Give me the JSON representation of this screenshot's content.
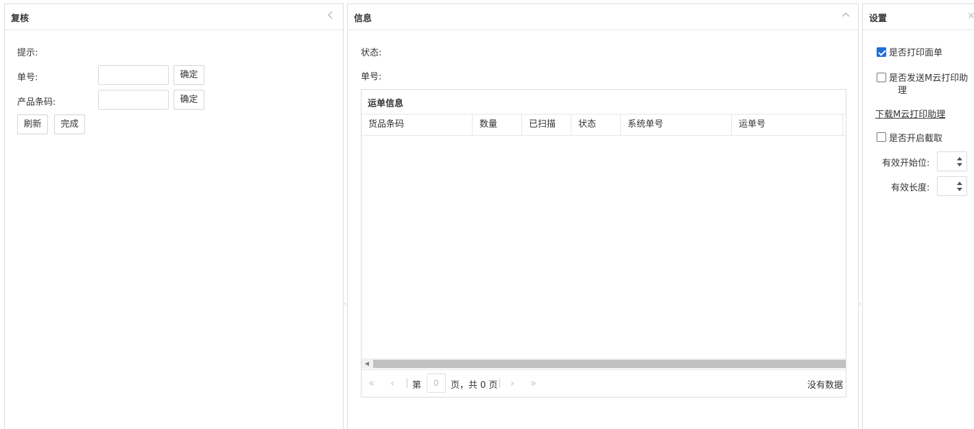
{
  "left_panel": {
    "title": "复核",
    "tip_label": "提示:",
    "order_label": "单号:",
    "barcode_label": "产品条码:",
    "confirm_label": "确定",
    "refresh_label": "刷新",
    "finish_label": "完成"
  },
  "mid_panel": {
    "title": "信息",
    "status_label": "状态:",
    "order_label": "单号:",
    "grid": {
      "title": "运单信息",
      "columns": [
        "货品条码",
        "数量",
        "已扫描",
        "状态",
        "系统单号",
        "运单号"
      ],
      "rows": []
    },
    "pager": {
      "page_prefix": "第",
      "page_value": "0",
      "page_suffix": "页，共 0 页",
      "empty_text": "没有数据"
    }
  },
  "right_panel": {
    "title": "设置",
    "print_sheet": {
      "label": "是否打印面单",
      "checked": true
    },
    "send_cloud": {
      "label_line1": "是否发送M云打印助",
      "label_line2": "理",
      "checked": false
    },
    "download_link": "下载M云打印助理",
    "enable_cut": {
      "label": "是否开启截取",
      "checked": false
    },
    "start_pos_label": "有效开始位:",
    "length_label": "有效长度:"
  },
  "icons": {
    "collapse_left": "chevron-left-icon",
    "collapse_up": "chevron-up-icon",
    "close": "close-icon"
  }
}
